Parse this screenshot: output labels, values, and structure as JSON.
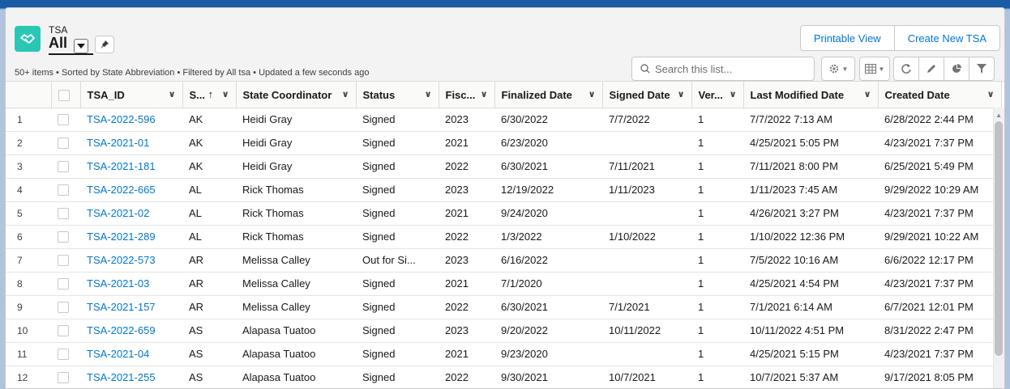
{
  "header": {
    "object_label": "TSA",
    "list_view_name": "All",
    "printable_view": "Printable View",
    "create_new": "Create New TSA",
    "meta_text": "50+ items • Sorted by State Abbreviation • Filtered by All tsa • Updated a few seconds ago"
  },
  "search": {
    "placeholder": "Search this list..."
  },
  "columns": [
    "TSA_ID",
    "S...",
    "State Coordinator",
    "Status",
    "Fisc...",
    "Finalized Date",
    "Signed Date",
    "Ver...",
    "Last Modified Date",
    "Created Date"
  ],
  "sort_indicator": "↑",
  "rows": [
    {
      "n": "1",
      "id": "TSA-2022-596",
      "st": "AK",
      "coord": "Heidi Gray",
      "status": "Signed",
      "fy": "2023",
      "fin": "6/30/2022",
      "signed": "7/7/2022",
      "ver": "1",
      "mod": "7/7/2022 7:13 AM",
      "created": "6/28/2022 2:44 PM"
    },
    {
      "n": "2",
      "id": "TSA-2021-01",
      "st": "AK",
      "coord": "Heidi Gray",
      "status": "Signed",
      "fy": "2021",
      "fin": "6/23/2020",
      "signed": "",
      "ver": "1",
      "mod": "4/25/2021 5:05 PM",
      "created": "4/23/2021 7:37 PM"
    },
    {
      "n": "3",
      "id": "TSA-2021-181",
      "st": "AK",
      "coord": "Heidi Gray",
      "status": "Signed",
      "fy": "2022",
      "fin": "6/30/2021",
      "signed": "7/11/2021",
      "ver": "1",
      "mod": "7/11/2021 8:00 PM",
      "created": "6/25/2021 5:49 PM"
    },
    {
      "n": "4",
      "id": "TSA-2022-665",
      "st": "AL",
      "coord": "Rick Thomas",
      "status": "Signed",
      "fy": "2023",
      "fin": "12/19/2022",
      "signed": "1/11/2023",
      "ver": "1",
      "mod": "1/11/2023 7:45 AM",
      "created": "9/29/2022 10:29 AM"
    },
    {
      "n": "5",
      "id": "TSA-2021-02",
      "st": "AL",
      "coord": "Rick Thomas",
      "status": "Signed",
      "fy": "2021",
      "fin": "9/24/2020",
      "signed": "",
      "ver": "1",
      "mod": "4/26/2021 3:27 PM",
      "created": "4/23/2021 7:37 PM"
    },
    {
      "n": "6",
      "id": "TSA-2021-289",
      "st": "AL",
      "coord": "Rick Thomas",
      "status": "Signed",
      "fy": "2022",
      "fin": "1/3/2022",
      "signed": "1/10/2022",
      "ver": "1",
      "mod": "1/10/2022 12:36 PM",
      "created": "9/29/2021 10:22 AM"
    },
    {
      "n": "7",
      "id": "TSA-2022-573",
      "st": "AR",
      "coord": "Melissa Calley",
      "status": "Out for Si...",
      "fy": "2023",
      "fin": "6/16/2022",
      "signed": "",
      "ver": "1",
      "mod": "7/5/2022 10:16 AM",
      "created": "6/6/2022 12:17 PM"
    },
    {
      "n": "8",
      "id": "TSA-2021-03",
      "st": "AR",
      "coord": "Melissa Calley",
      "status": "Signed",
      "fy": "2021",
      "fin": "7/1/2020",
      "signed": "",
      "ver": "1",
      "mod": "4/25/2021 4:54 PM",
      "created": "4/23/2021 7:37 PM"
    },
    {
      "n": "9",
      "id": "TSA-2021-157",
      "st": "AR",
      "coord": "Melissa Calley",
      "status": "Signed",
      "fy": "2022",
      "fin": "6/30/2021",
      "signed": "7/1/2021",
      "ver": "1",
      "mod": "7/1/2021 6:14 AM",
      "created": "6/7/2021 12:01 PM"
    },
    {
      "n": "10",
      "id": "TSA-2022-659",
      "st": "AS",
      "coord": "Alapasa Tuatoo",
      "status": "Signed",
      "fy": "2023",
      "fin": "9/20/2022",
      "signed": "10/11/2022",
      "ver": "1",
      "mod": "10/11/2022 4:51 PM",
      "created": "8/31/2022 2:47 PM"
    },
    {
      "n": "11",
      "id": "TSA-2021-04",
      "st": "AS",
      "coord": "Alapasa Tuatoo",
      "status": "Signed",
      "fy": "2021",
      "fin": "9/23/2020",
      "signed": "",
      "ver": "1",
      "mod": "4/25/2021 5:15 PM",
      "created": "4/23/2021 7:37 PM"
    },
    {
      "n": "12",
      "id": "TSA-2021-255",
      "st": "AS",
      "coord": "Alapasa Tuatoo",
      "status": "Signed",
      "fy": "2022",
      "fin": "9/30/2021",
      "signed": "10/7/2021",
      "ver": "1",
      "mod": "10/7/2021 5:37 AM",
      "created": "9/17/2021 8:05 PM"
    }
  ],
  "colors": {
    "brand_icon": "#2bc7b5",
    "link": "#0176d3",
    "header_bg": "#f3f3f3"
  },
  "icons": [
    "handshake-icon",
    "chevron-down-icon",
    "pin-icon",
    "search-icon",
    "gear-icon",
    "table-icon",
    "refresh-icon",
    "pencil-icon",
    "pie-chart-icon",
    "filter-icon"
  ]
}
